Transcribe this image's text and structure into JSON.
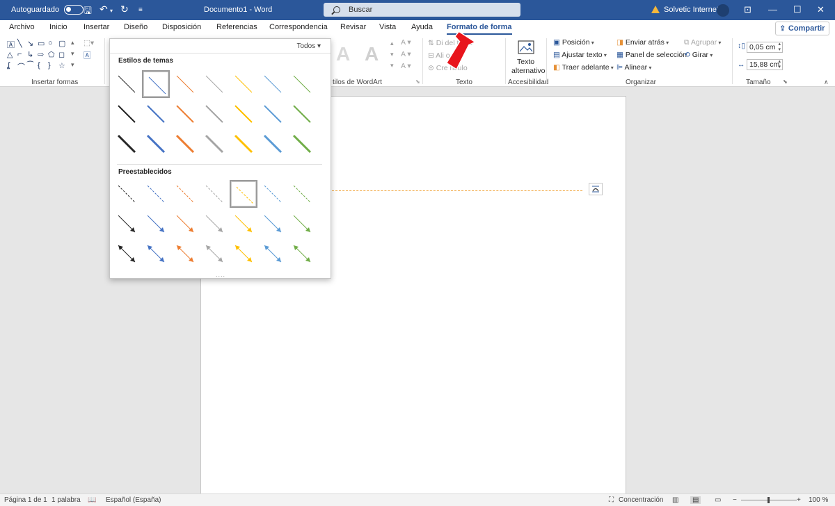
{
  "titlebar": {
    "autosave_label": "Autoguardado",
    "doc_title": "Documento1  -  Word",
    "search_placeholder": "Buscar",
    "user_name": "Solvetic Internet"
  },
  "tabs": [
    {
      "label": "Archivo"
    },
    {
      "label": "Inicio"
    },
    {
      "label": "Insertar"
    },
    {
      "label": "Diseño"
    },
    {
      "label": "Disposición"
    },
    {
      "label": "Referencias"
    },
    {
      "label": "Correspondencia"
    },
    {
      "label": "Revisar"
    },
    {
      "label": "Vista"
    },
    {
      "label": "Ayuda"
    },
    {
      "label": "Formato de forma"
    }
  ],
  "share_label": "Compartir",
  "ribbon": {
    "insert_shapes_label": "Insertar formas",
    "wordart_label": "tilos de WordArt",
    "text_group_label": "Texto",
    "text_direction": "Di        del texto",
    "align_text": "Ali           o",
    "create_link": "Cre          nculo",
    "alt_text_line1": "Texto",
    "alt_text_line2": "alternativo",
    "accessibility_label": "Accesibilidad",
    "position": "Posición",
    "wrap_text": "Ajustar texto",
    "bring_forward": "Traer adelante",
    "send_backward": "Enviar atrás",
    "selection_pane": "Panel de selección",
    "align": "Alinear",
    "group": "Agrupar",
    "rotate": "Girar",
    "arrange_label": "Organizar",
    "height_value": "0,05 cm",
    "width_value": "15,88 cm",
    "size_label": "Tamaño"
  },
  "gallery": {
    "filter_label": "Todos",
    "theme_styles_heading": "Estilos de temas",
    "presets_heading": "Preestablecidos",
    "grip": "....",
    "colors": [
      "#262626",
      "#4472c4",
      "#ed7d31",
      "#a5a5a5",
      "#ffc000",
      "#5b9bd5",
      "#70ad47"
    ]
  },
  "status": {
    "page": "Página 1 de 1",
    "words": "1 palabra",
    "language": "Español (España)",
    "focus": "Concentración",
    "zoom": "100 %"
  }
}
